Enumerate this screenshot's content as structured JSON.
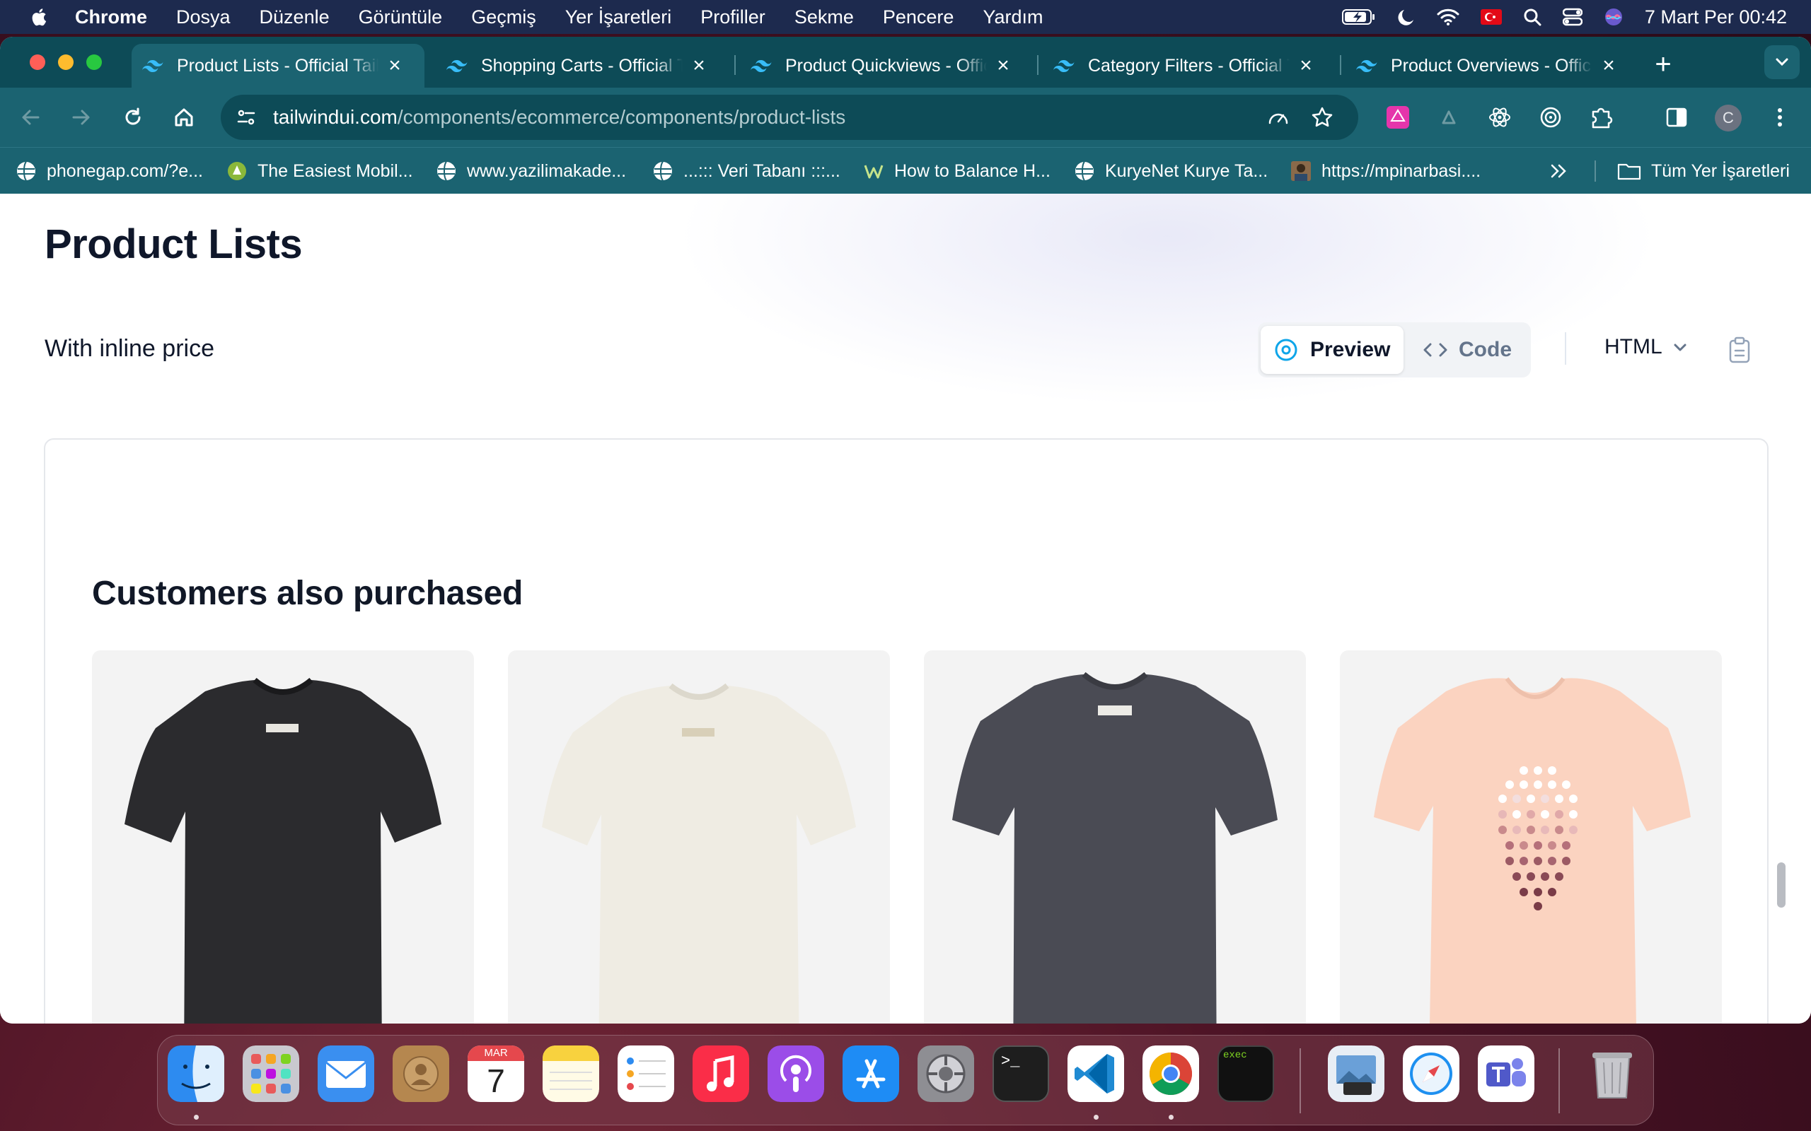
{
  "menubar": {
    "app_name": "Chrome",
    "items": [
      "Dosya",
      "Düzenle",
      "Görüntüle",
      "Geçmiş",
      "Yer İşaretleri",
      "Profiller",
      "Sekme",
      "Pencere",
      "Yardım"
    ],
    "clock": "7 Mart Per  00:42"
  },
  "tabs": [
    {
      "title": "Product Lists - Official Tailwind",
      "active": true
    },
    {
      "title": "Shopping Carts - Official Tailwind",
      "active": false
    },
    {
      "title": "Product Quickviews - Official",
      "active": false
    },
    {
      "title": "Category Filters - Official Tailwind",
      "active": false
    },
    {
      "title": "Product Overviews - Official",
      "active": false
    }
  ],
  "address": {
    "host": "tailwindui.com",
    "path": "/components/ecommerce/components/product-lists"
  },
  "profile_initial": "C",
  "bookmarks": [
    {
      "label": "phonegap.com/?e...",
      "icon": "globe-icon"
    },
    {
      "label": "The Easiest Mobil...",
      "icon": "site-icon"
    },
    {
      "label": "www.yazilimakade...",
      "icon": "globe-icon"
    },
    {
      "label": "...::: Veri Tabanı :::...",
      "icon": "globe-icon"
    },
    {
      "label": "How to Balance H...",
      "icon": "w-icon"
    },
    {
      "label": "KuryeNet Kurye Ta...",
      "icon": "globe-icon"
    },
    {
      "label": "https://mpinarbasi....",
      "icon": "avatar-icon"
    }
  ],
  "bookmarks_all": "Tüm Yer İşaretleri",
  "page": {
    "title": "Product Lists",
    "section": "With inline price",
    "preview_label": "Preview",
    "code_label": "Code",
    "language": "HTML",
    "preview_heading": "Customers also purchased"
  },
  "products": [
    {
      "color": "#2b2b2e",
      "name": "black-tshirt"
    },
    {
      "color": "#efece3",
      "name": "white-tshirt"
    },
    {
      "color": "#4a4b54",
      "name": "charcoal-tshirt"
    },
    {
      "color": "#fbd3c0",
      "name": "peach-tshirt"
    }
  ],
  "dock": {
    "calendar_month": "MAR",
    "calendar_day": "7",
    "terminal_prompt": ">_",
    "exec_label": "exec"
  }
}
